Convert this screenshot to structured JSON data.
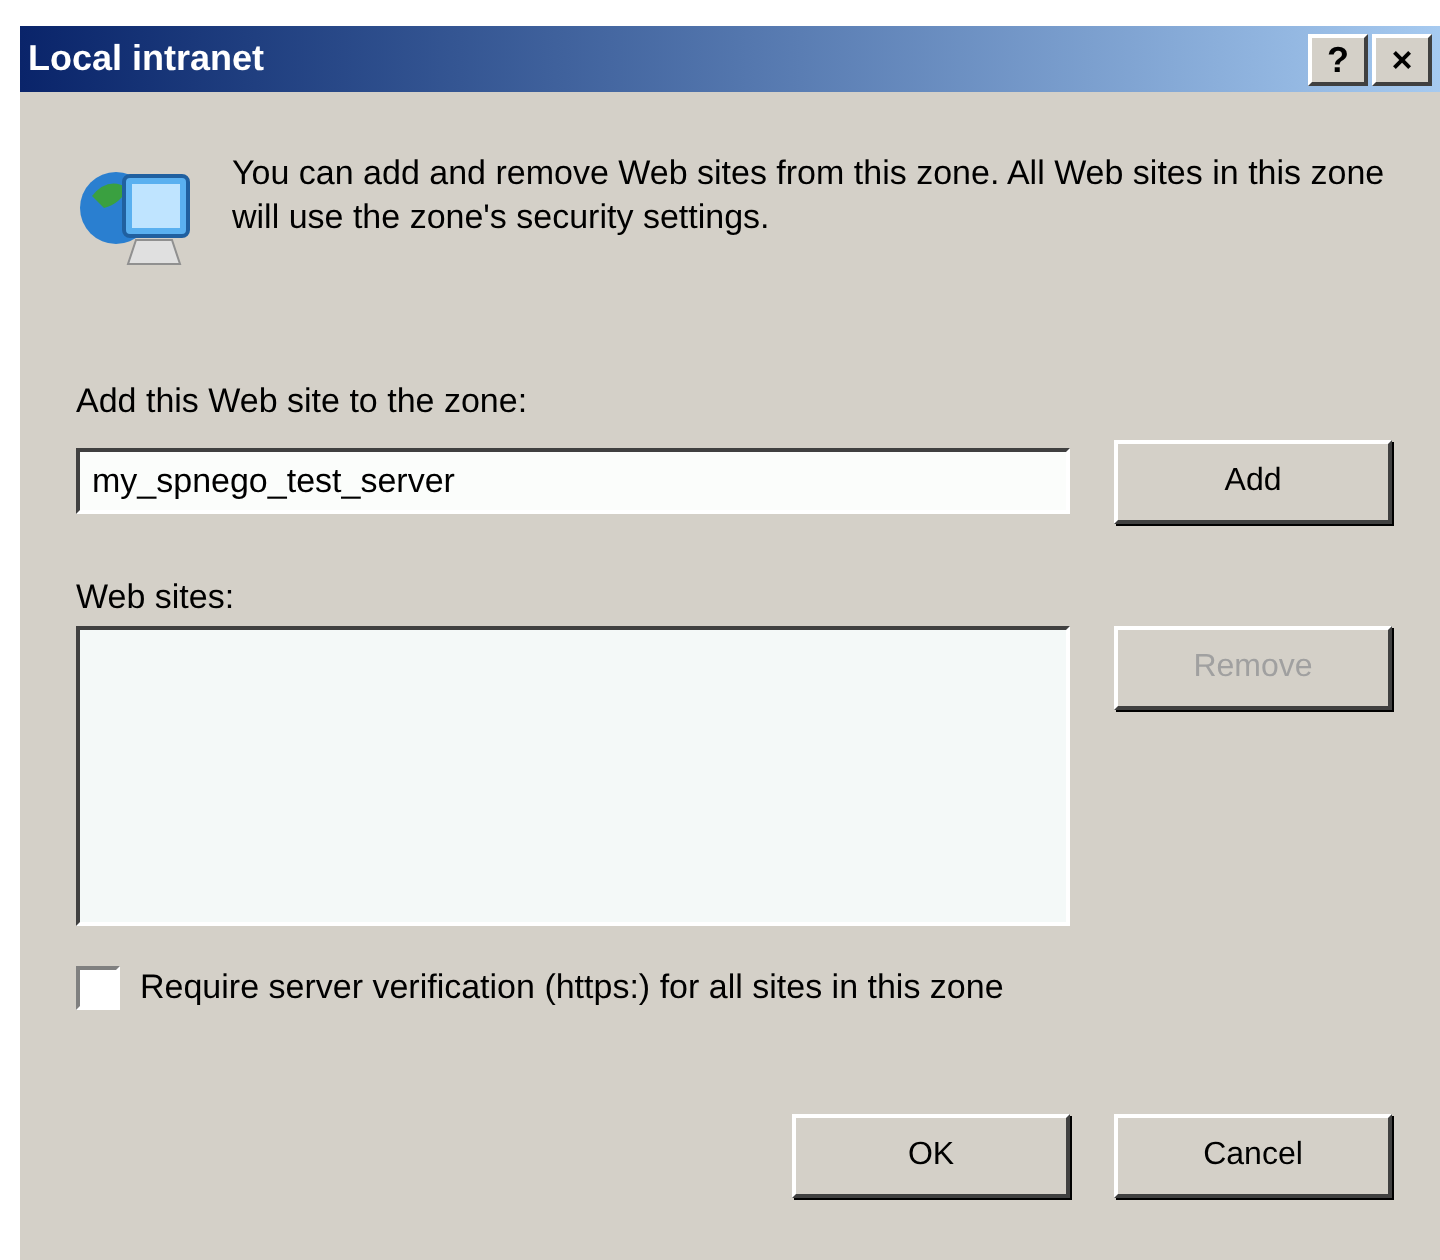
{
  "window": {
    "title": "Local intranet",
    "title_buttons": [
      "?",
      "×"
    ]
  },
  "description": "You can add and remove Web sites from this zone. All Web sites in this zone will use the zone's security settings.",
  "add_label": "Add this Web site to the zone:",
  "add_field": {
    "value": "my_spnego_test_server"
  },
  "add_button": {
    "label": "Add",
    "disabled": false
  },
  "sites_label": "Web sites:",
  "remove_button": {
    "label": "Remove",
    "disabled": true
  },
  "require_https": {
    "label": "Require server verification (https:) for all sites in this zone",
    "checked": false
  },
  "buttons": [
    "OK",
    "Cancel"
  ]
}
